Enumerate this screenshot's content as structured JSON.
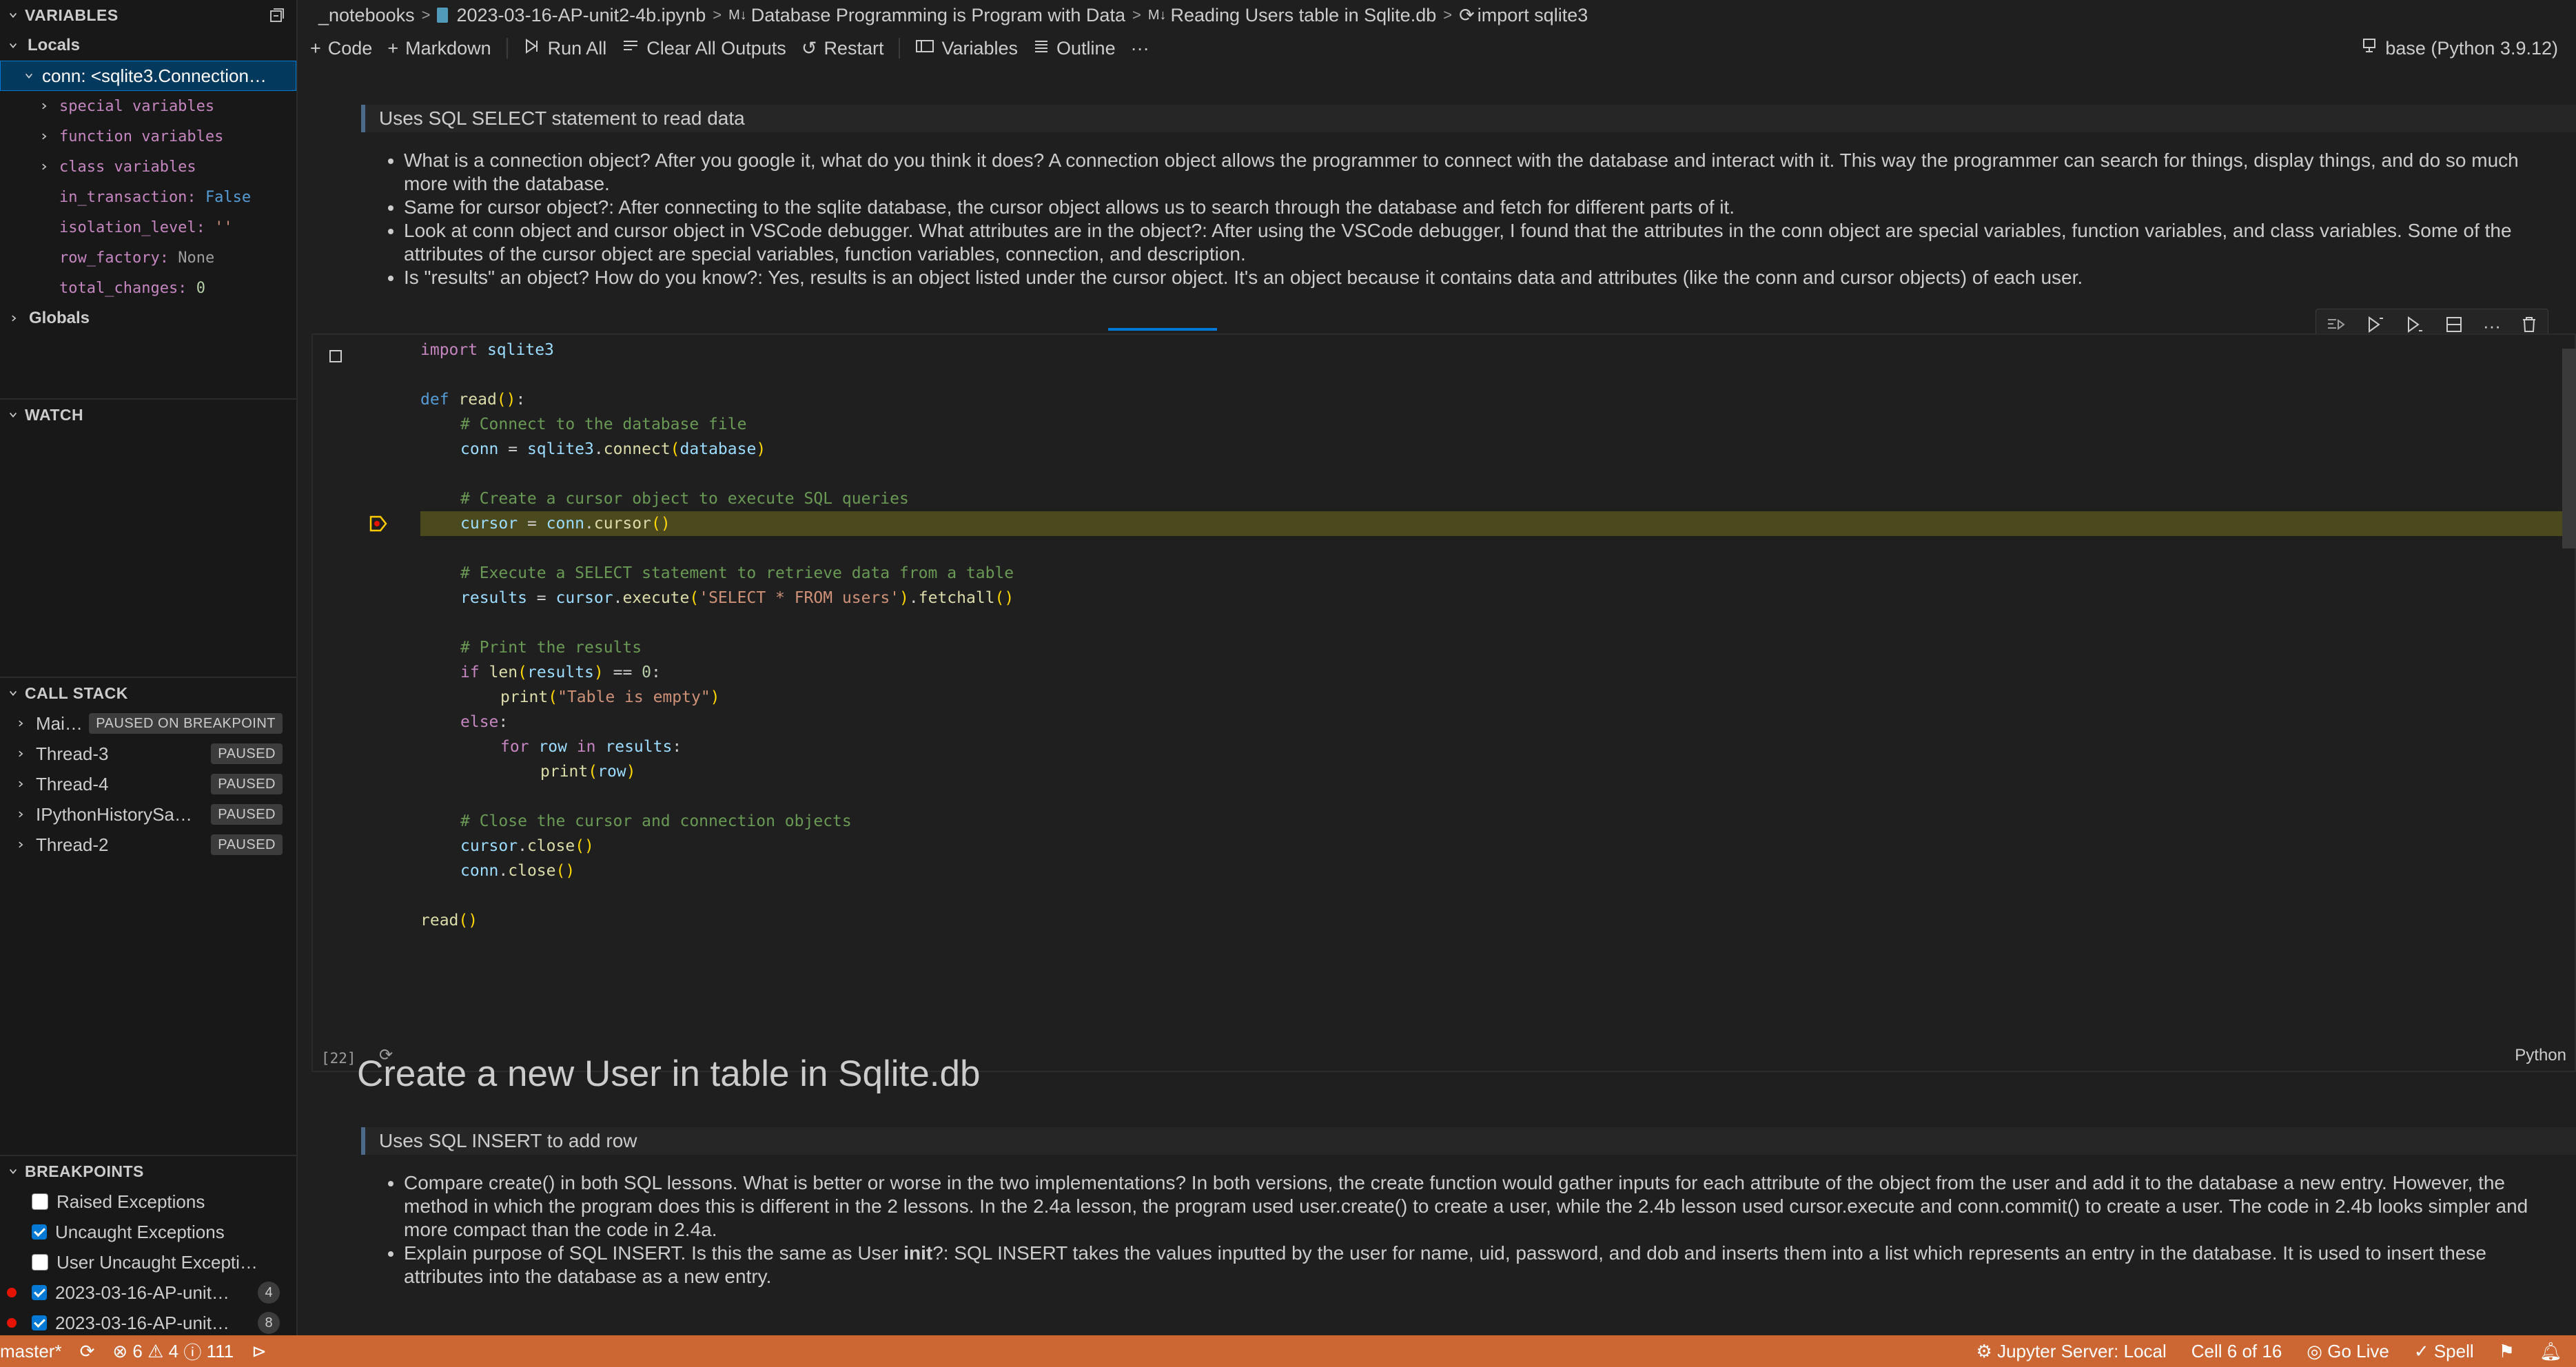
{
  "sidebar": {
    "variables_title": "VARIABLES",
    "locals_label": "Locals",
    "conn_label": "conn: <sqlite3.Connection…",
    "children": [
      {
        "name": "special variables"
      },
      {
        "name": "function variables"
      },
      {
        "name": "class variables"
      }
    ],
    "attrs": [
      {
        "name": "in_transaction:",
        "value": "False"
      },
      {
        "name": "isolation_level:",
        "value": "''"
      },
      {
        "name": "row_factory:",
        "value": "None"
      },
      {
        "name": "total_changes:",
        "value": "0"
      }
    ],
    "globals_label": "Globals",
    "watch_title": "WATCH",
    "callstack_title": "CALL STACK",
    "threads": [
      {
        "name": "Mai…",
        "status": "PAUSED ON BREAKPOINT"
      },
      {
        "name": "Thread-3",
        "status": "PAUSED"
      },
      {
        "name": "Thread-4",
        "status": "PAUSED"
      },
      {
        "name": "IPythonHistorySa…",
        "status": "PAUSED"
      },
      {
        "name": "Thread-2",
        "status": "PAUSED"
      }
    ],
    "breakpoints_title": "BREAKPOINTS",
    "breakpoints": [
      {
        "label": "Raised Exceptions",
        "checked": false
      },
      {
        "label": "Uncaught Exceptions",
        "checked": true
      },
      {
        "label": "User Uncaught Excepti…",
        "checked": false
      },
      {
        "label": "2023-03-16-AP-unit…",
        "checked": true,
        "count": "4"
      },
      {
        "label": "2023-03-16-AP-unit…",
        "checked": true,
        "count": "8"
      }
    ]
  },
  "breadcrumb": {
    "folder": "_notebooks",
    "file": "2023-03-16-AP-unit2-4b.ipynb",
    "md_prefix_1": "M↓",
    "section1": "Database Programming is Program with Data",
    "md_prefix_2": "M↓",
    "section2": "Reading Users table in Sqlite.db",
    "cell": "import sqlite3"
  },
  "toolbar": {
    "code": "Code",
    "markdown": "Markdown",
    "run_all": "Run All",
    "clear_outputs": "Clear All Outputs",
    "restart": "Restart",
    "variables": "Variables",
    "outline": "Outline",
    "more": "···",
    "kernel": "base (Python 3.9.12)"
  },
  "notebook": {
    "quote1": "Uses SQL SELECT statement to read data",
    "bullets1": [
      "What is a connection object? After you google it, what do you think it does? A connection object allows the programmer to connect with the database and interact with it. This way the programmer can search for things, display things, and do so much more with the database.",
      "Same for cursor object?: After connecting to the sqlite database, the cursor object allows us to search through the database and fetch for different parts of it.",
      "Look at conn object and cursor object in VSCode debugger. What attributes are in the object?: After using the VSCode debugger, I found that the attributes in the conn object are special variables, function variables, and class variables. Some of the attributes of the cursor object are special variables, function variables, connection, and description.",
      "Is \"results\" an object? How do you know?: Yes, results is an object listed under the cursor object. It's an object because it contains data and attributes (like the conn and cursor objects) of each user."
    ],
    "cell_exec_count": "[22]",
    "cell_language": "Python",
    "heading2": "Create a new User in table in Sqlite.db",
    "quote2": "Uses SQL INSERT to add row",
    "bullets2": [
      "Compare create() in both SQL lessons. What is better or worse in the two implementations? In both versions, the create function would gather inputs for each attribute of the object from the user and add it to the database a new entry. However, the method in which the program does this is different in the 2 lessons. In the 2.4a lesson, the program used user.create() to create a user, while the 2.4b lesson used cursor.execute and conn.commit() to create a user. The code in 2.4b looks simpler and more compact than the code in 2.4a."
    ],
    "bullet2b_pre": "Explain purpose of SQL INSERT. Is this the same as User ",
    "bullet2b_bold": "init",
    "bullet2b_post": "?: SQL INSERT takes the values inputted by the user for name, uid, password, and dob and inserts them into a list which represents an entry in the database. It is used to insert these attributes into the database as a new entry."
  },
  "code": {
    "l1_kw": "import",
    "l1_mod": "sqlite3",
    "l2_kw": "def",
    "l2_fn": "read",
    "c1": "# Connect to the database file",
    "l4_var": "conn",
    "l4_mod": "sqlite3",
    "l4_fn": "connect",
    "l4_arg": "database",
    "c2": "# Create a cursor object to execute SQL queries",
    "l6_var": "cursor",
    "l6_obj": "conn",
    "l6_fn": "cursor",
    "c3": "# Execute a SELECT statement to retrieve data from a table",
    "l8_var": "results",
    "l8_obj": "cursor",
    "l8_fn": "execute",
    "l8_str": "'SELECT * FROM users'",
    "l8_fn2": "fetchall",
    "c4": "# Print the results",
    "l10_kw": "if",
    "l10_fn": "len",
    "l10_var": "results",
    "l10_num": "0",
    "l11_fn": "print",
    "l11_str": "\"Table is empty\"",
    "l12_kw": "else",
    "l13_kw": "for",
    "l13_var": "row",
    "l13_kw2": "in",
    "l13_var2": "results",
    "l14_fn": "print",
    "l14_var": "row",
    "c5": "# Close the cursor and connection objects",
    "l16_obj": "cursor",
    "l16_fn": "close",
    "l17_obj": "conn",
    "l17_fn": "close",
    "l18_fn": "read"
  },
  "status": {
    "branch": "master*",
    "errors": "6",
    "warnings": "4",
    "info": "111",
    "jupyter": "Jupyter Server: Local",
    "cell_pos": "Cell 6 of 16",
    "go_live": "Go Live",
    "spell": "Spell"
  },
  "colors": {
    "status_bar": "#cc6633",
    "highlight_line": "#4b4a1f",
    "accent": "#0078d4"
  }
}
